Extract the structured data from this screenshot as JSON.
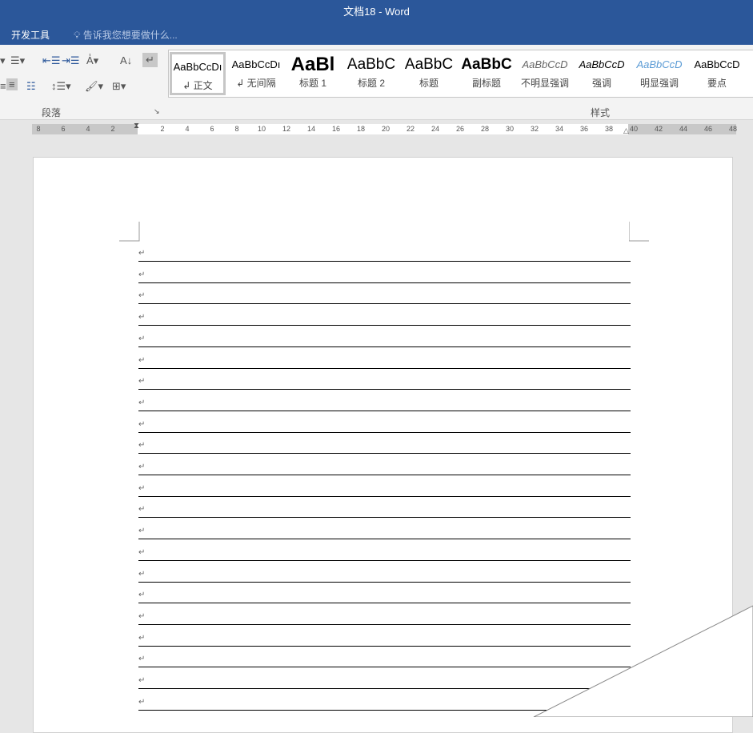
{
  "window": {
    "title": "文档18 - Word"
  },
  "tabs": {
    "developer": "开发工具",
    "tell_me": "告诉我您想要做什么..."
  },
  "ribbon": {
    "paragraph_group": "段落",
    "styles_group": "样式",
    "styles": [
      {
        "preview": "AaBbCcDı",
        "name": "↲ 正文"
      },
      {
        "preview": "AaBbCcDı",
        "name": "↲ 无间隔"
      },
      {
        "preview": "AaBl",
        "name": "标题 1"
      },
      {
        "preview": "AaBbC",
        "name": "标题 2"
      },
      {
        "preview": "AaBbC",
        "name": "标题"
      },
      {
        "preview": "AaBbC",
        "name": "副标题"
      },
      {
        "preview": "AaBbCcD",
        "name": "不明显强调"
      },
      {
        "preview": "AaBbCcD",
        "name": "强调"
      },
      {
        "preview": "AaBbCcD",
        "name": "明显强调"
      },
      {
        "preview": "AaBbCcD",
        "name": "要点"
      }
    ]
  },
  "ruler": {
    "left": [
      "8",
      "6",
      "4",
      "2"
    ],
    "right": [
      "2",
      "4",
      "6",
      "8",
      "10",
      "12",
      "14",
      "16",
      "18",
      "20",
      "22",
      "24",
      "26",
      "28",
      "30",
      "32",
      "34",
      "36",
      "38",
      "40",
      "42",
      "44",
      "46",
      "48"
    ]
  },
  "document": {
    "paragraph_mark": "↵",
    "line_count": 22
  },
  "colors": {
    "accent": "#2b579a"
  }
}
